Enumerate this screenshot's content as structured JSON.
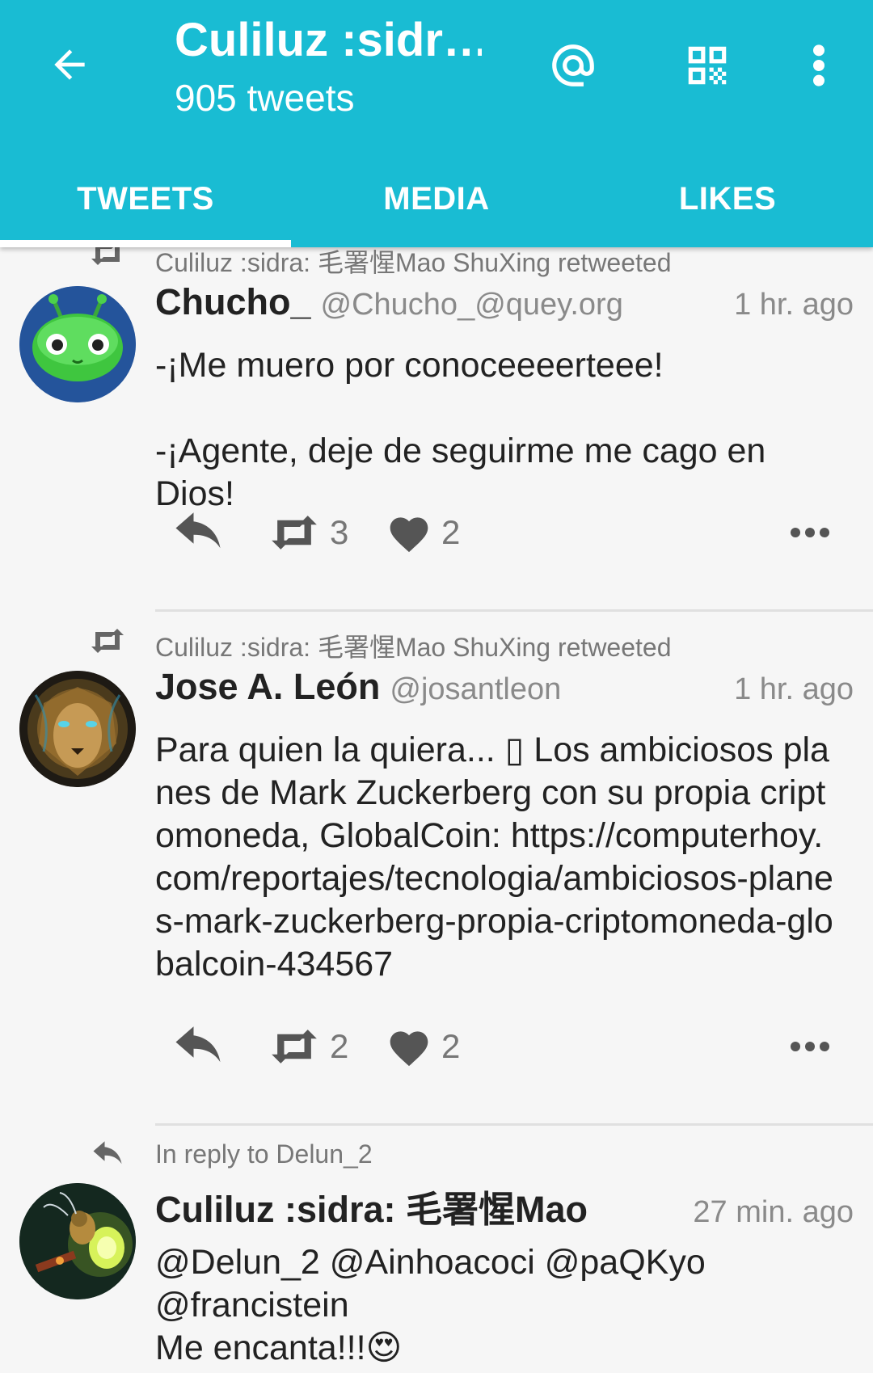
{
  "header": {
    "title": "Culiluz :sidr…",
    "subtitle": "905 tweets",
    "icons": [
      "back-arrow-icon",
      "at-icon",
      "qr-code-icon",
      "more-vert-icon"
    ]
  },
  "tabs": [
    {
      "label": "TWEETS",
      "active": true
    },
    {
      "label": "MEDIA",
      "active": false
    },
    {
      "label": "LIKES",
      "active": false
    }
  ],
  "tweets": [
    {
      "context": "Culiluz :sidra: 毛署惺Mao ShuXing retweeted",
      "context_icon": "retweet-icon",
      "name": "Chucho_",
      "handle": "@Chucho_@quey.org",
      "time": "1 hr. ago",
      "text": "-¡Me muero por conoceeeerteee!\n\n-¡Agente, deje de seguirme me cago en Dios!",
      "retweets": "3",
      "likes": "2"
    },
    {
      "context": "Culiluz :sidra: 毛署惺Mao ShuXing retweeted",
      "context_icon": "retweet-icon",
      "name": "Jose A. León",
      "handle": "@josantleon",
      "time": "1 hr. ago",
      "text": "Para quien la quiera... ▯ Los ambiciosos planes de Mark Zuckerberg con su propia criptomoneda, GlobalCoin: https://computerhoy.com/reportajes/tecnologia/ambiciosos-planes-mark-zuckerberg-propia-criptomoneda-globalcoin-434567",
      "retweets": "2",
      "likes": "2"
    },
    {
      "context": "In reply to Delun_2",
      "context_icon": "reply-icon",
      "name": "Culiluz :sidra: 毛署惺Mao",
      "handle": "",
      "time": "27 min. ago",
      "text": "@Delun_2 @Ainhoacoci @paQKyo @francistein\nMe encanta!!!😍"
    }
  ],
  "colors": {
    "accent": "#19bcd3",
    "icon_gray": "#555555",
    "text_primary": "#222222",
    "text_secondary": "#8a8a8a",
    "background": "#f6f6f6"
  }
}
